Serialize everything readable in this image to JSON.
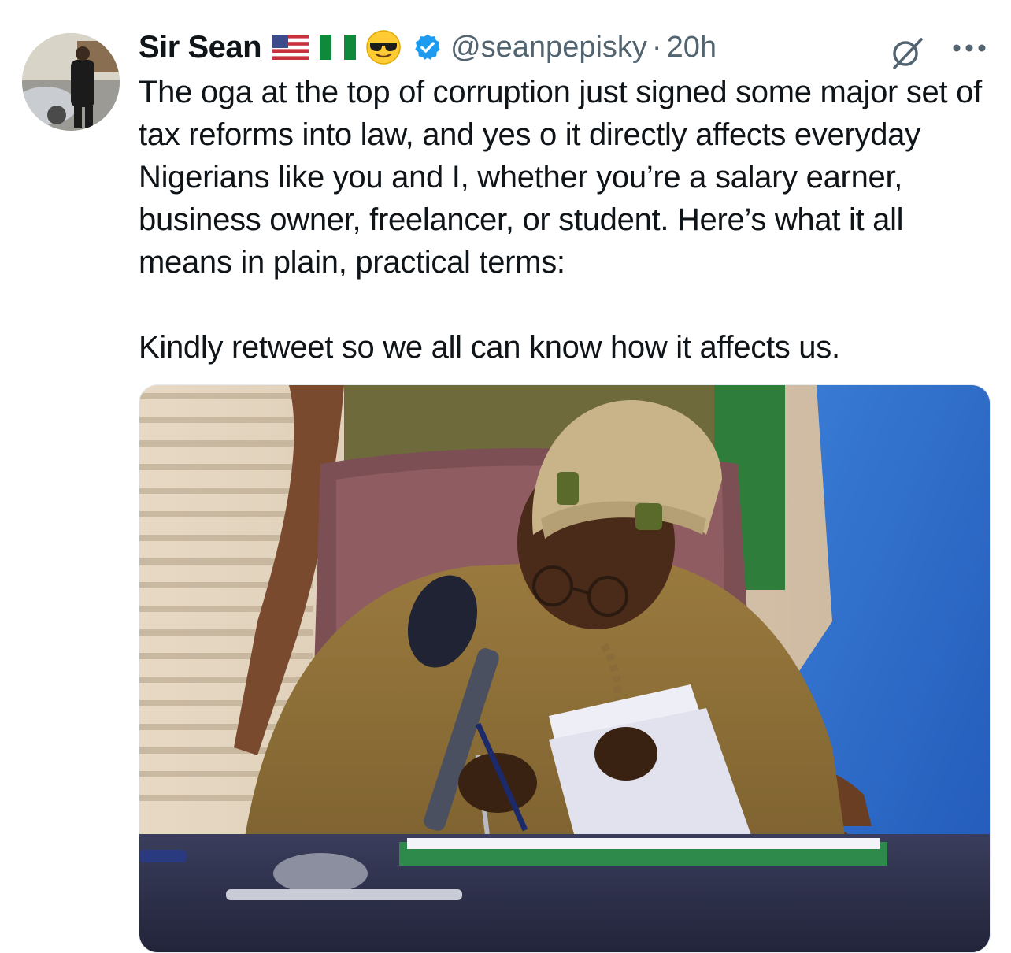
{
  "tweet": {
    "author": {
      "display_name": "Sir Sean",
      "emojis": [
        "us-flag",
        "nigeria-flag",
        "sunglasses-face"
      ],
      "handle": "@seanpepisky",
      "verified": true
    },
    "separator": "·",
    "timestamp": "20h",
    "text": {
      "paragraph1": "The oga at the top of corruption just signed some major set of tax reforms into law, and yes o it directly affects everyday Nigerians like you and I, whether you’re a salary earner, business owner, freelancer, or student. Here’s what it all means in plain, practical terms:",
      "paragraph2": "Kindly retweet so we all can know how it affects us."
    },
    "media": {
      "type": "photo",
      "subject": "man-in-agbada-signing-documents"
    }
  },
  "colors": {
    "text_primary": "#0f1419",
    "text_secondary": "#536471",
    "verified_blue": "#1d9bf0",
    "background": "#ffffff"
  },
  "icons": {
    "grok": "grok-icon",
    "more": "more-icon",
    "verified": "verified-badge-icon"
  }
}
